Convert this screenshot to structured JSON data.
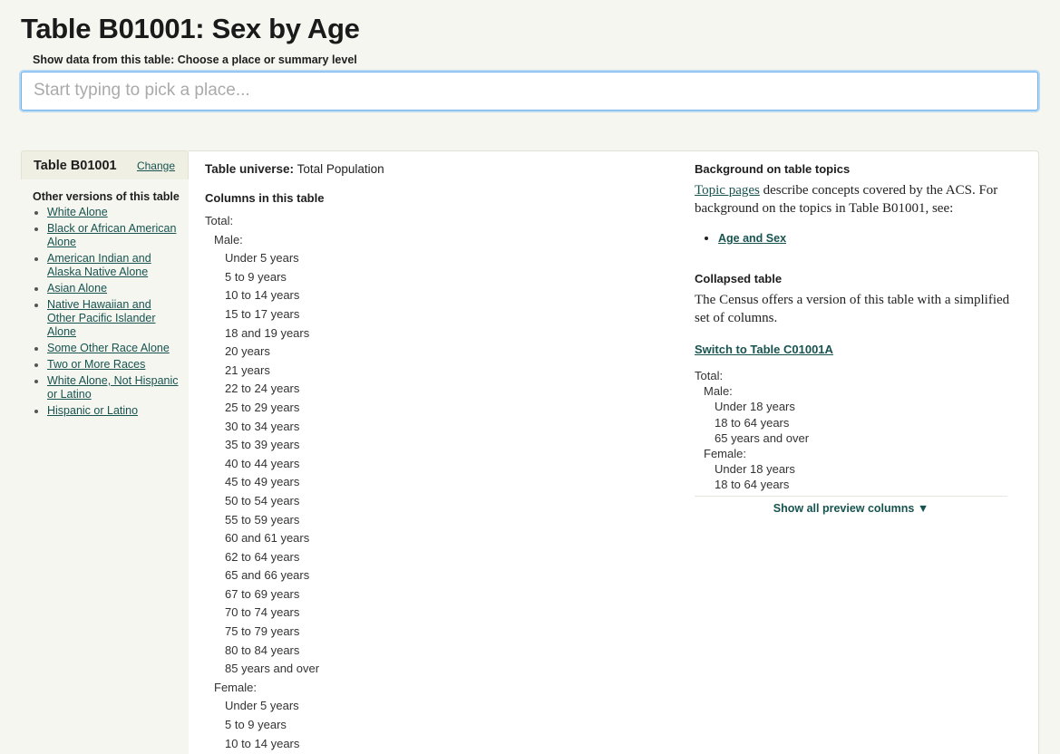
{
  "header": {
    "title": "Table B01001: Sex by Age",
    "search_label": "Show data from this table: Choose a place or summary level",
    "search_placeholder": "Start typing to pick a place...",
    "search_value": ""
  },
  "sidebar": {
    "table_id": "Table B01001",
    "change_label": "Change",
    "other_versions_title": "Other versions of this table",
    "other_versions": [
      "White Alone",
      "Black or African American Alone",
      "American Indian and Alaska Native Alone",
      "Asian Alone",
      "Native Hawaiian and Other Pacific Islander Alone",
      "Some Other Race Alone",
      "Two or More Races",
      "White Alone, Not Hispanic or Latino",
      "Hispanic or Latino"
    ]
  },
  "main": {
    "universe_label": "Table universe:",
    "universe_value": "Total Population",
    "columns_heading": "Columns in this table",
    "columns": [
      {
        "label": "Total:",
        "level": 0
      },
      {
        "label": "Male:",
        "level": 1
      },
      {
        "label": "Under 5 years",
        "level": 2
      },
      {
        "label": "5 to 9 years",
        "level": 2
      },
      {
        "label": "10 to 14 years",
        "level": 2
      },
      {
        "label": "15 to 17 years",
        "level": 2
      },
      {
        "label": "18 and 19 years",
        "level": 2
      },
      {
        "label": "20 years",
        "level": 2
      },
      {
        "label": "21 years",
        "level": 2
      },
      {
        "label": "22 to 24 years",
        "level": 2
      },
      {
        "label": "25 to 29 years",
        "level": 2
      },
      {
        "label": "30 to 34 years",
        "level": 2
      },
      {
        "label": "35 to 39 years",
        "level": 2
      },
      {
        "label": "40 to 44 years",
        "level": 2
      },
      {
        "label": "45 to 49 years",
        "level": 2
      },
      {
        "label": "50 to 54 years",
        "level": 2
      },
      {
        "label": "55 to 59 years",
        "level": 2
      },
      {
        "label": "60 and 61 years",
        "level": 2
      },
      {
        "label": "62 to 64 years",
        "level": 2
      },
      {
        "label": "65 and 66 years",
        "level": 2
      },
      {
        "label": "67 to 69 years",
        "level": 2
      },
      {
        "label": "70 to 74 years",
        "level": 2
      },
      {
        "label": "75 to 79 years",
        "level": 2
      },
      {
        "label": "80 to 84 years",
        "level": 2
      },
      {
        "label": "85 years and over",
        "level": 2
      },
      {
        "label": "Female:",
        "level": 1
      },
      {
        "label": "Under 5 years",
        "level": 2
      },
      {
        "label": "5 to 9 years",
        "level": 2
      },
      {
        "label": "10 to 14 years",
        "level": 2
      }
    ]
  },
  "aside": {
    "background_heading": "Background on table topics",
    "background_link": "Topic pages",
    "background_text": " describe concepts covered by the ACS. For background on the topics in Table B01001, see:",
    "topics": [
      "Age and Sex"
    ],
    "collapsed_heading": "Collapsed table",
    "collapsed_text": "The Census offers a version of this table with a simplified set of columns.",
    "switch_link": "Switch to Table C01001A",
    "preview_columns": [
      {
        "label": "Total:",
        "level": 0
      },
      {
        "label": "Male:",
        "level": 1
      },
      {
        "label": "Under 18 years",
        "level": 2
      },
      {
        "label": "18 to 64 years",
        "level": 2
      },
      {
        "label": "65 years and over",
        "level": 2
      },
      {
        "label": "Female:",
        "level": 1
      },
      {
        "label": "Under 18 years",
        "level": 2
      },
      {
        "label": "18 to 64 years",
        "level": 2
      }
    ],
    "show_all_label": "Show all preview columns ▼"
  }
}
